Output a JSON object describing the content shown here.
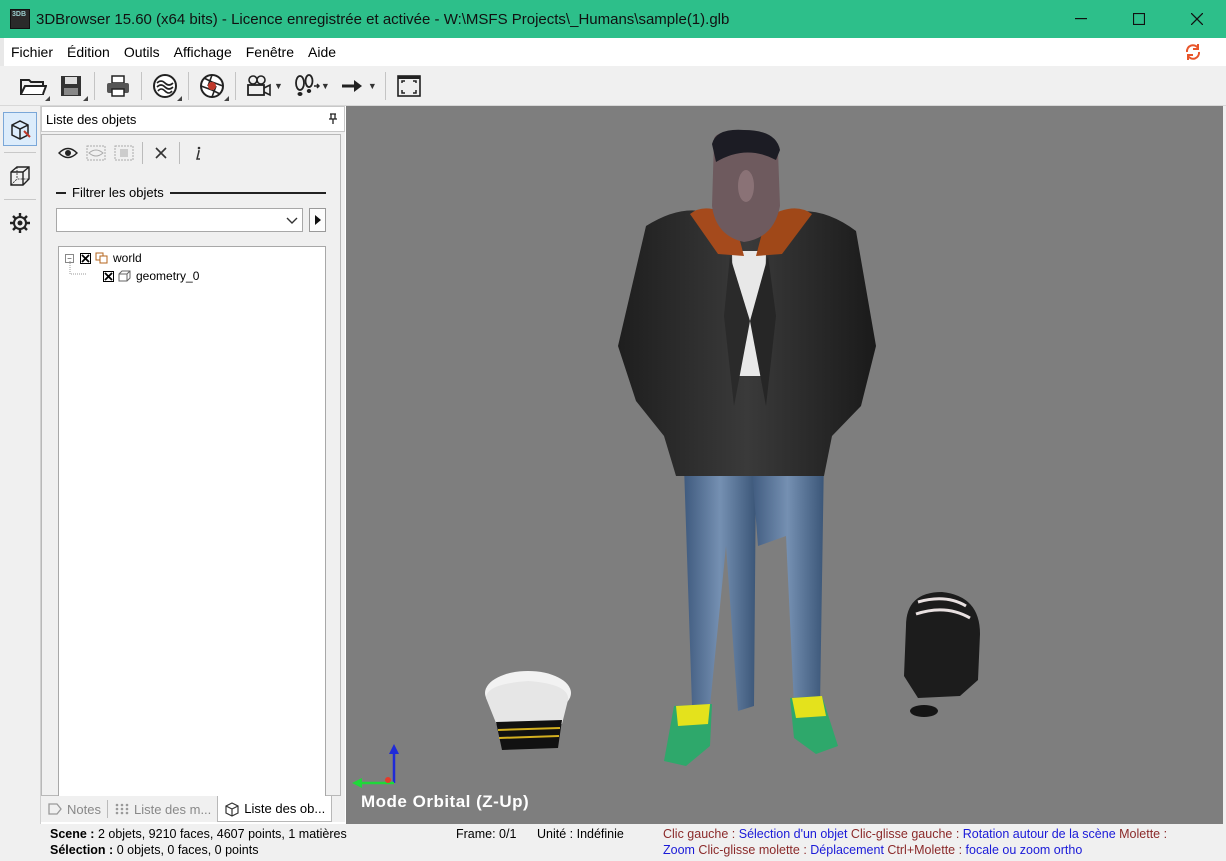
{
  "window": {
    "title": "3DBrowser 15.60 (x64 bits) - Licence enregistrée  et activée - W:\\MSFS Projects\\_Humans\\sample(1).glb",
    "icon_text": "3DB"
  },
  "menu": [
    "Fichier",
    "Édition",
    "Outils",
    "Affichage",
    "Fenêtre",
    "Aide"
  ],
  "toolbar_icons": [
    "open-folder-icon",
    "save-icon",
    "print-icon",
    "waves-icon",
    "aperture-icon",
    "camera-icon",
    "footsteps-icon",
    "arrow-right-icon",
    "fullscreen-icon"
  ],
  "panel": {
    "title": "Liste des objets",
    "filter_label": "Filtrer les objets",
    "filter_value": "",
    "tree": [
      {
        "label": "world",
        "checked": true,
        "expanded": true
      },
      {
        "label": "geometry_0",
        "checked": true
      }
    ]
  },
  "bottom_tabs": [
    "Notes",
    "Liste des m...",
    "Liste des ob..."
  ],
  "viewport": {
    "mode_label": "Mode Orbital (Z-Up)"
  },
  "status": {
    "scene_key": "Scene :",
    "scene_val": "2 objets,  9210 faces,  4607 points,  1 matières",
    "selection_key": "Sélection :",
    "selection_val": "0 objets,  0 faces,  0 points",
    "frame": "Frame: 0/1",
    "unit": "Unité : Indéfinie",
    "hint1_k1": "Clic gauche : ",
    "hint1_v1": "Sélection d'un objet",
    "hint1_k2": " Clic-glisse gauche : ",
    "hint1_v2": "Rotation autour de la scène",
    "hint1_k3": " Molette :",
    "hint2_v1": "Zoom",
    "hint2_k1": " Clic-glisse molette : ",
    "hint2_v2": "Déplacement",
    "hint2_k2": " Ctrl+Molette : ",
    "hint2_v3": "focale ou zoom ortho"
  },
  "colors": {
    "titlebar": "#2dbf8a",
    "viewport_bg": "#7e7e7e",
    "refresh_accent": "#e8552a"
  }
}
